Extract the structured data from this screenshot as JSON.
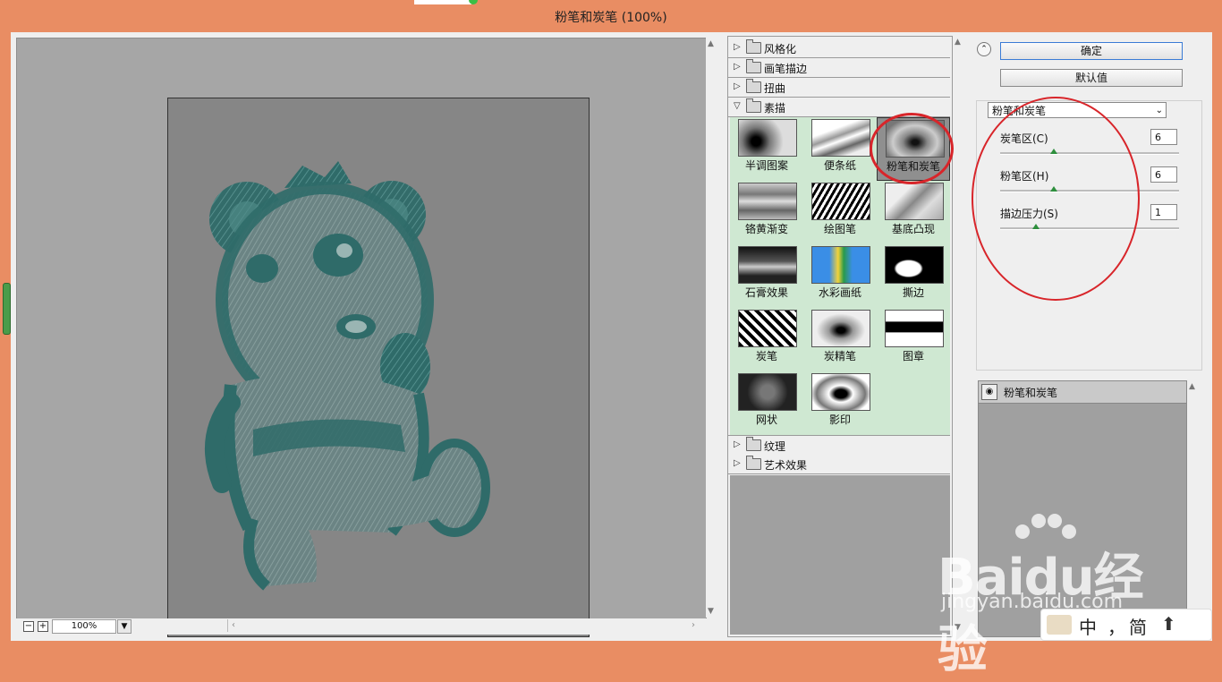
{
  "window": {
    "title": "粉笔和炭笔 (100%)"
  },
  "preview": {
    "zoom": "100%"
  },
  "filters": {
    "categories_top": [
      "风格化",
      "画笔描边",
      "扭曲"
    ],
    "open_category": "素描",
    "items": [
      "半调图案",
      "便条纸",
      "粉笔和炭笔",
      "铬黄渐变",
      "绘图笔",
      "基底凸现",
      "石膏效果",
      "水彩画纸",
      "撕边",
      "炭笔",
      "炭精笔",
      "图章",
      "网状",
      "影印"
    ],
    "selected": "粉笔和炭笔",
    "categories_bottom": [
      "纹理",
      "艺术效果"
    ]
  },
  "buttons": {
    "ok": "确定",
    "default": "默认值"
  },
  "settings": {
    "filter_name": "粉笔和炭笔",
    "params": [
      {
        "label": "炭笔区(C)",
        "value": "6",
        "fraction": 0.3
      },
      {
        "label": "粉笔区(H)",
        "value": "6",
        "fraction": 0.3
      },
      {
        "label": "描边压力(S)",
        "value": "1",
        "fraction": 0.2
      }
    ]
  },
  "layers": {
    "items": [
      "粉笔和炭笔"
    ]
  },
  "watermark": {
    "brand": "Baidu经验",
    "url": "jingyan.baidu.com"
  },
  "ime": {
    "mode": "中",
    "punct": "，",
    "script": "简"
  },
  "colors": {
    "accent": "#e98d63",
    "annotation": "#d8252a",
    "thumb_bg": "#cfe8d2",
    "slider": "#2e8f3d"
  }
}
